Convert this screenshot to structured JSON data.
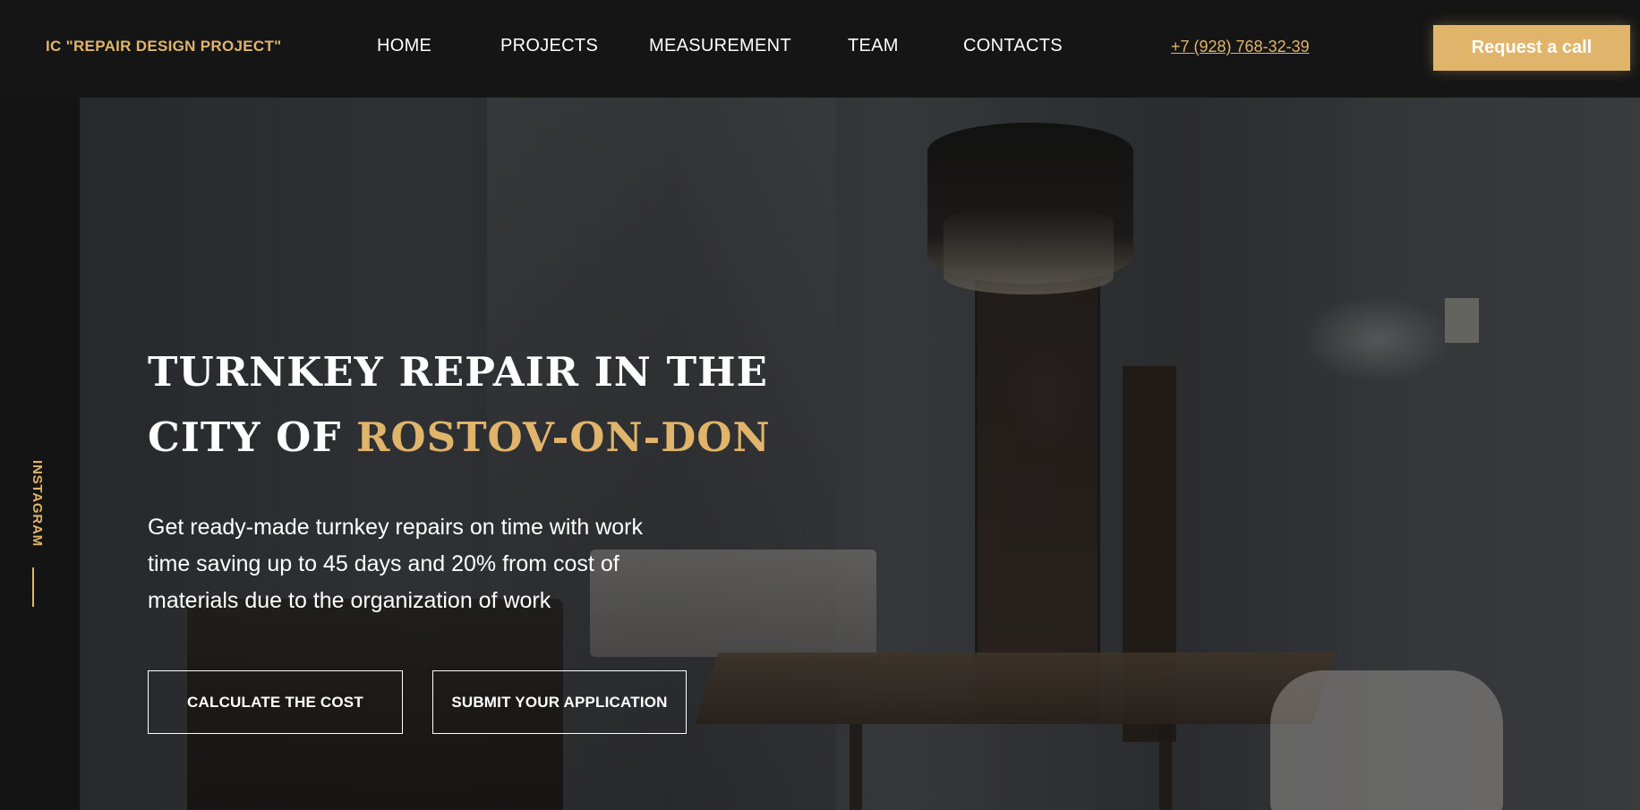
{
  "header": {
    "logo": "IC \"REPAIR DESIGN PROJECT\"",
    "nav": [
      {
        "label": "HOME"
      },
      {
        "label": "PROJECTS"
      },
      {
        "label": "MEASUREMENT"
      },
      {
        "label": "TEAM"
      },
      {
        "label": "CONTACTS"
      }
    ],
    "phone": "+7 (928) 768-32-39",
    "cta_label": "Request a call"
  },
  "side": {
    "instagram_label": "INSTAGRAM"
  },
  "hero": {
    "title_line1": "TURNKEY REPAIR IN THE",
    "title_line2_prefix": "CITY OF ",
    "title_line2_highlight": "ROSTOV-ON-DON",
    "description": "Get ready-made turnkey repairs on time with work time saving up to 45 days and 20% from cost of materials due to the organization of work",
    "btn_calculate": "CALCULATE THE COST",
    "btn_submit": "SUBMIT YOUR APPLICATION"
  },
  "colors": {
    "accent": "#e0b56b",
    "background": "#141414"
  }
}
